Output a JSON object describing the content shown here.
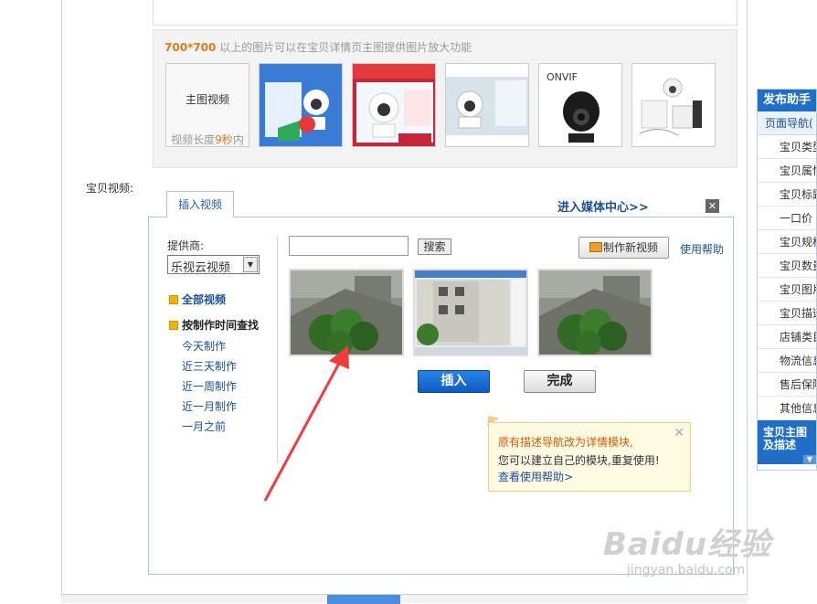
{
  "thumbs": {
    "hint_size": "700*700",
    "hint_text": "以上的图片可以在宝贝详情页主图提供图片放大功能",
    "main_label": "主图视频",
    "length_prefix": "视频长度",
    "length_value": "9秒",
    "length_suffix": "内"
  },
  "video_label": "宝贝视频:",
  "tab_insert": "插入视频",
  "media_center": "进入媒体中心>>",
  "provider": {
    "label": "提供商:",
    "selected": "乐视云视频"
  },
  "nav": {
    "all": "全部视频",
    "by_time": "按制作时间查找",
    "items": [
      "今天制作",
      "近三天制作",
      "近一周制作",
      "近一月制作",
      "一月之前"
    ]
  },
  "search": {
    "button": "搜索",
    "value": ""
  },
  "make_new": "制作新视频",
  "help": "使用帮助",
  "actions": {
    "insert": "插入",
    "done": "完成"
  },
  "tip": {
    "line1": "原有描述导航改为详情模块,",
    "line2": "您可以建立自己的模块,重复使用!",
    "line3": "查看使用帮助>"
  },
  "sidebar": {
    "title": "发布助手",
    "sub": "页面导航(",
    "items": [
      "宝贝类型",
      "宝贝属性",
      "宝贝标题",
      "一口价",
      "宝贝规格",
      "宝贝数量",
      "宝贝图片",
      "宝贝描述",
      "店铺类目",
      "物流信息",
      "售后保障",
      "其他信息"
    ],
    "active": "宝贝主图及描述"
  },
  "watermark": {
    "main": "Baidu经验",
    "url": "jingyan.baidu.com"
  },
  "colors": {
    "accent": "#1f6fc9",
    "link": "#1a4f99",
    "highlight": "#e07a1f",
    "arrow": "#f03c3c"
  }
}
